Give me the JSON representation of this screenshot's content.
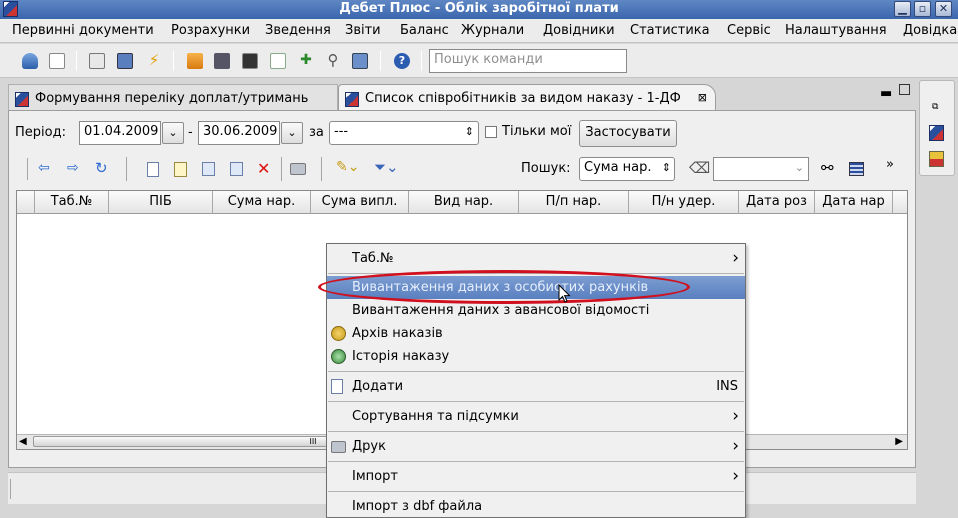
{
  "window": {
    "title": "Дебет Плюс - Облік заробітної плати"
  },
  "menu": [
    "Первинні документи",
    "Розрахунки",
    "Зведення",
    "Звіти",
    "Баланс",
    "Журнали",
    "Довідники",
    "Статистика",
    "Сервіс",
    "Налаштування",
    "Довідка"
  ],
  "toolbar": {
    "command_search_placeholder": "Пошук команди"
  },
  "tabs": [
    {
      "label": "Формування переліку доплат/утримань"
    },
    {
      "label": "Список співробітників за видом наказу - 1-ДФ",
      "close": "⊠"
    }
  ],
  "filter": {
    "period_label": "Період:",
    "date_from": "01.04.2009",
    "dash": "-",
    "date_to": "30.06.2009",
    "by_label": "за",
    "by_value": "---",
    "only_mine_label": "Тільки мої",
    "apply_button": "Застосувати"
  },
  "grid_toolbar": {
    "search_label": "Пошук:",
    "search_field": "Сума нар.",
    "more": "»"
  },
  "grid": {
    "columns": [
      "Таб.№",
      "ПІБ",
      "Сума нар.",
      "Сума випл.",
      "Вид нар.",
      "П/п нар.",
      "П/н удер.",
      "Дата роз",
      "Дата нар"
    ],
    "scroll_glyph": "III"
  },
  "context_menu": {
    "items": [
      {
        "label": "Таб.№",
        "submenu": true
      },
      {
        "label": "Вивантаження даних з особистих рахунків",
        "highlighted": true
      },
      {
        "label": "Вивантаження даних з авансової відомості"
      },
      {
        "label": "Архів наказів",
        "icon": "archive-icon"
      },
      {
        "label": "Історія наказу",
        "icon": "history-icon"
      },
      {
        "label": "Додати",
        "icon": "new-document-icon",
        "shortcut": "INS"
      },
      {
        "label": "Сортування та підсумки",
        "submenu": true
      },
      {
        "label": "Друк",
        "icon": "printer-icon",
        "submenu": true
      },
      {
        "label": "Імпорт",
        "submenu": true
      },
      {
        "label": "Імпорт з dbf файла"
      }
    ]
  },
  "colors": {
    "highlight": "#5a80c0",
    "annotation": "#d0101e",
    "titlebar": "#3a66ad"
  }
}
